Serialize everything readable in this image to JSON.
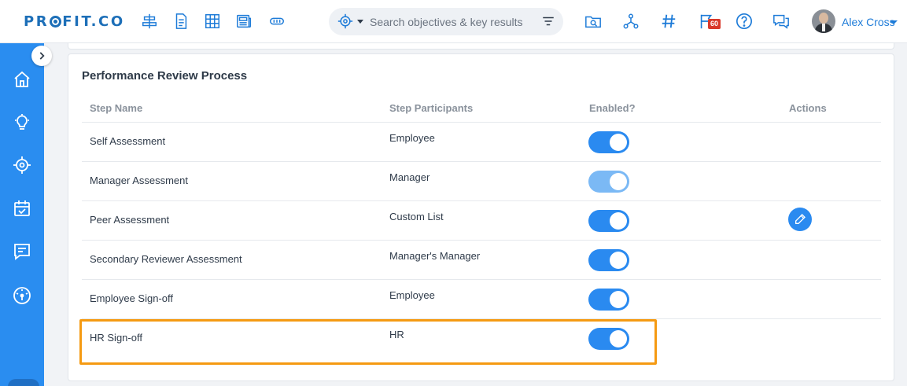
{
  "header": {
    "logo_text": "PROFIT.CO",
    "search_placeholder": "Search objectives & key results",
    "notification_count": "60",
    "user_name": "Alex Cross",
    "nav_icons": [
      "align-center-icon",
      "document-icon",
      "grid-icon",
      "newspaper-icon",
      "badge-icon"
    ],
    "action_icons": [
      "folder-search-icon",
      "hierarchy-icon",
      "hashtag-icon",
      "flag-icon",
      "help-icon",
      "chat-icon"
    ]
  },
  "sidebar": {
    "items": [
      "home-icon",
      "lightbulb-icon",
      "target-icon",
      "calendar-check-icon",
      "feedback-icon",
      "dashboard-gauge-icon"
    ]
  },
  "section": {
    "title": "Performance Review Process",
    "columns": {
      "step_name": "Step Name",
      "participants": "Step Participants",
      "enabled": "Enabled?",
      "actions": "Actions"
    },
    "rows": [
      {
        "name": "Self Assessment",
        "participants": "Employee",
        "enabled": true,
        "toggle_disabled": false,
        "editable": false
      },
      {
        "name": "Manager Assessment",
        "participants": "Manager",
        "enabled": true,
        "toggle_disabled": true,
        "editable": false
      },
      {
        "name": "Peer Assessment",
        "participants": "Custom List",
        "enabled": true,
        "toggle_disabled": false,
        "editable": true
      },
      {
        "name": "Secondary Reviewer Assessment",
        "participants": "Manager's Manager",
        "enabled": true,
        "toggle_disabled": false,
        "editable": false
      },
      {
        "name": "Employee Sign-off",
        "participants": "Employee",
        "enabled": true,
        "toggle_disabled": false,
        "editable": false
      },
      {
        "name": "HR Sign-off",
        "participants": "HR",
        "enabled": true,
        "toggle_disabled": false,
        "editable": false
      }
    ]
  },
  "colors": {
    "brand": "#1d6fb8",
    "sidebar": "#2a8df0",
    "toggle_on": "#2a8af0",
    "toggle_disabled": "#7bb9f5",
    "highlight": "#f59a12",
    "badge": "#d9392b"
  }
}
